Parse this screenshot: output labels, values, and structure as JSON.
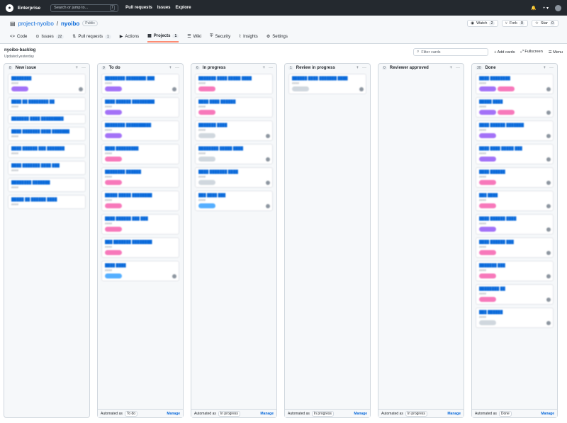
{
  "top": {
    "brand": "Enterprise",
    "search_placeholder": "Search or jump to...",
    "search_key": "/",
    "nav": [
      "Pull requests",
      "Issues",
      "Explore"
    ],
    "plus": "+ ▾"
  },
  "repo": {
    "owner": "project-nyoibo",
    "name": "nyoibo",
    "visibility": "Public",
    "watch": {
      "label": "Watch",
      "count": "2"
    },
    "fork": {
      "label": "Fork",
      "count": "0"
    },
    "star": {
      "label": "Star",
      "count": "0"
    },
    "tabs": [
      {
        "label": "Code",
        "icon": "<>",
        "count": ""
      },
      {
        "label": "Issues",
        "icon": "⊙",
        "count": "22"
      },
      {
        "label": "Pull requests",
        "icon": "⇅",
        "count": "1"
      },
      {
        "label": "Actions",
        "icon": "▶",
        "count": ""
      },
      {
        "label": "Projects",
        "icon": "▦",
        "count": "1"
      },
      {
        "label": "Wiki",
        "icon": "☰",
        "count": ""
      },
      {
        "label": "Security",
        "icon": "⛨",
        "count": ""
      },
      {
        "label": "Insights",
        "icon": "⌇",
        "count": ""
      },
      {
        "label": "Settings",
        "icon": "⚙",
        "count": ""
      }
    ]
  },
  "project": {
    "title": "nyoibo-backlog",
    "updated": "Updated yesterday",
    "filter_placeholder": "Filter cards",
    "add_cards": "+ Add cards",
    "fullscreen": "Fullscreen",
    "menu": "Menu"
  },
  "colors": {
    "purple": "#a371f7",
    "pink": "#f778ba",
    "blue": "#54aeff",
    "gray": "#d0d7de"
  },
  "columns": [
    {
      "title": "New issue",
      "count": "8",
      "automated": "",
      "manage": "",
      "cards": [
        {
          "t": "████████",
          "m": "####",
          "labels": [
            "purple"
          ],
          "av": true
        },
        {
          "t": "████ ██ ████████ ██",
          "m": "####",
          "labels": [],
          "av": false
        },
        {
          "t": "███████ ████ █████████",
          "m": "",
          "labels": [],
          "av": false
        },
        {
          "t": "████ ███████ ████ ███████",
          "m": "####",
          "labels": [],
          "av": false
        },
        {
          "t": "████ ██████ ███ ███████",
          "m": "####",
          "labels": [],
          "av": false
        },
        {
          "t": "████ ███████ ████ ███",
          "m": "####",
          "labels": [],
          "av": false
        },
        {
          "t": "████████ ███████",
          "m": "####",
          "labels": [],
          "av": false
        },
        {
          "t": "█████ ██ ██████ ████",
          "m": "####",
          "labels": [],
          "av": false
        }
      ]
    },
    {
      "title": "To do",
      "count": "9",
      "automated": "To do",
      "manage": "Manage",
      "cards": [
        {
          "t": "████████ ████████ ███",
          "m": "####",
          "labels": [
            "purple"
          ],
          "av": true
        },
        {
          "t": "████ ██████ █████████",
          "m": "####",
          "labels": [
            "purple"
          ],
          "av": false
        },
        {
          "t": "████████ ██████████",
          "m": "####",
          "labels": [
            "purple"
          ],
          "av": false
        },
        {
          "t": "████ █████████",
          "m": "####",
          "labels": [
            "pink"
          ],
          "av": false
        },
        {
          "t": "████████ ██████",
          "m": "####",
          "labels": [
            "pink"
          ],
          "av": false
        },
        {
          "t": "█████ █████ ████████",
          "m": "####",
          "labels": [
            "pink"
          ],
          "av": false
        },
        {
          "t": "████ ██████ ███ ███",
          "m": "####",
          "labels": [
            "pink"
          ],
          "av": false
        },
        {
          "t": "███ ███████ ████████",
          "m": "####",
          "labels": [
            "pink"
          ],
          "av": false
        },
        {
          "t": "████ ████",
          "m": "####",
          "labels": [
            "blue"
          ],
          "av": true
        }
      ]
    },
    {
      "title": "In progress",
      "count": "6",
      "automated": "In progress",
      "manage": "Manage",
      "cards": [
        {
          "t": "███████ ████ █████ ████",
          "m": "####",
          "labels": [
            "pink"
          ],
          "av": false
        },
        {
          "t": "████ ████ ██████",
          "m": "####",
          "labels": [
            "pink"
          ],
          "av": false
        },
        {
          "t": "███████ ████",
          "m": "####",
          "labels": [
            "gray"
          ],
          "av": true
        },
        {
          "t": "████████ █████ ████",
          "m": "####",
          "labels": [
            "gray"
          ],
          "av": true
        },
        {
          "t": "████ ███████ ████",
          "m": "####",
          "labels": [
            "gray"
          ],
          "av": true
        },
        {
          "t": "███ ████ ███",
          "m": "####",
          "labels": [
            "blue"
          ],
          "av": true
        }
      ]
    },
    {
      "title": "Review in progress",
      "count": "1",
      "automated": "In progress",
      "manage": "Manage",
      "cards": [
        {
          "t": "██████ ████ ███████ ████",
          "m": "####",
          "labels": [
            "gray"
          ],
          "av": true
        }
      ]
    },
    {
      "title": "Reviewer approved",
      "count": "0",
      "automated": "In progress",
      "manage": "Manage",
      "cards": []
    },
    {
      "title": "Done",
      "count": "30",
      "automated": "Done",
      "manage": "Manage",
      "cards": [
        {
          "t": "████ ████████",
          "m": "####",
          "labels": [
            "purple",
            "pink"
          ],
          "av": true
        },
        {
          "t": "█████ ████",
          "m": "####",
          "labels": [
            "purple",
            "pink"
          ],
          "av": true
        },
        {
          "t": "████ ██████ ███████",
          "m": "####",
          "labels": [
            "purple"
          ],
          "av": true
        },
        {
          "t": "████ ████ █████ ███",
          "m": "####",
          "labels": [
            "purple"
          ],
          "av": true
        },
        {
          "t": "████ ██████",
          "m": "####",
          "labels": [
            "pink"
          ],
          "av": true
        },
        {
          "t": "███ ████",
          "m": "####",
          "labels": [
            "pink"
          ],
          "av": true
        },
        {
          "t": "████ ██████ ████",
          "m": "####",
          "labels": [
            "purple"
          ],
          "av": true
        },
        {
          "t": "████ ██████ ███",
          "m": "####",
          "labels": [
            "pink"
          ],
          "av": true
        },
        {
          "t": "███████ ███",
          "m": "####",
          "labels": [
            "pink"
          ],
          "av": true
        },
        {
          "t": "████████ ██",
          "m": "####",
          "labels": [
            "pink"
          ],
          "av": true
        },
        {
          "t": "███ ██████",
          "m": "####",
          "labels": [
            "gray"
          ],
          "av": true
        }
      ]
    }
  ],
  "automated_prefix": "Automated as"
}
